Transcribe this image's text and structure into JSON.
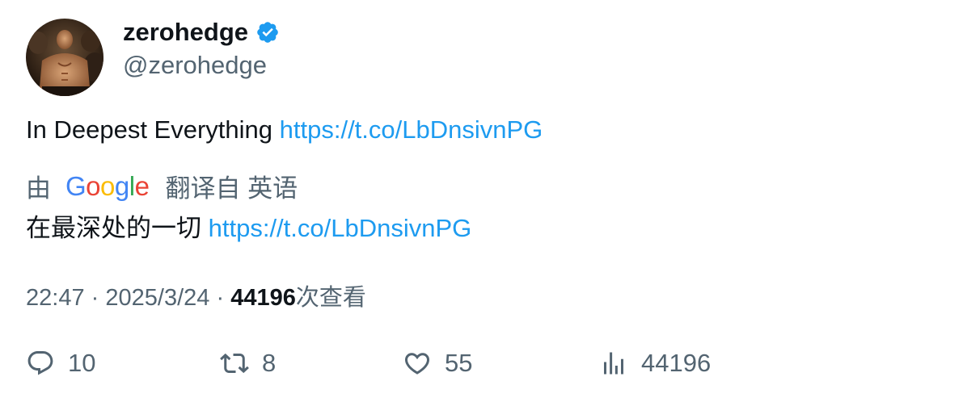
{
  "tweet": {
    "display_name": "zerohedge",
    "handle": "@zerohedge",
    "text": "In Deepest Everything",
    "link": "https://t.co/LbDnsivnPG",
    "translation": {
      "prefix": "由",
      "provider": "Google",
      "suffix": "翻译自 英语",
      "text": "在最深处的一切",
      "link": "https://t.co/LbDnsivnPG"
    },
    "time": "22:47",
    "date": "2025/3/24",
    "views_count": "44196",
    "views_label": "次查看",
    "separator": "·"
  },
  "actions": {
    "replies": "10",
    "retweets": "8",
    "likes": "55",
    "views": "44196"
  },
  "colors": {
    "link": "#1d9bf0",
    "verified": "#1d9bf0",
    "secondary_text": "#536471"
  },
  "icons": {
    "verified": "verified-badge-icon",
    "reply": "reply-icon",
    "retweet": "retweet-icon",
    "like": "heart-icon",
    "views": "analytics-icon"
  }
}
